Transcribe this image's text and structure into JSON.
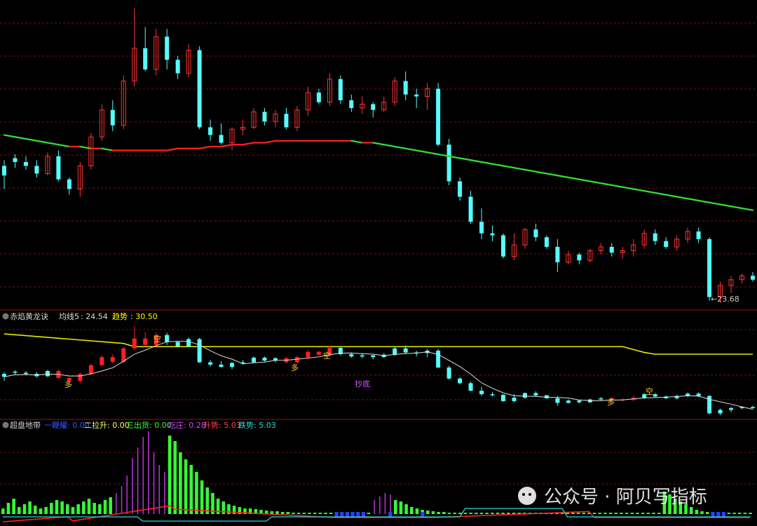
{
  "chart_data": [
    {
      "type": "candlestick",
      "panel": "main",
      "annotations": [
        "23.68"
      ],
      "series": [
        {
          "name": "ma_long",
          "values": [
            30.2,
            30.1,
            30.0,
            29.9,
            29.8,
            29.7,
            29.6,
            29.6,
            29.5,
            29.5,
            29.4,
            29.4,
            29.4,
            29.4,
            29.4,
            29.4,
            29.5,
            29.5,
            29.5,
            29.6,
            29.6,
            29.7,
            29.7,
            29.8,
            29.8,
            29.9,
            29.9,
            29.9,
            29.9,
            29.9,
            29.9,
            29.9,
            29.9,
            29.8,
            29.8,
            29.7,
            29.6,
            29.5,
            29.4,
            29.3,
            29.2,
            29.1,
            29.0,
            28.9,
            28.8,
            28.7,
            28.6,
            28.5,
            28.4,
            28.3,
            28.2,
            28.1,
            28.0,
            27.9,
            27.8,
            27.7,
            27.6,
            27.5,
            27.4,
            27.3,
            27.2,
            27.1,
            27.0,
            26.9,
            26.8,
            26.7,
            26.6,
            26.5,
            26.4,
            26.3
          ]
        }
      ],
      "candles": [
        [
          28.6,
          28.9,
          27.4,
          28.1
        ],
        [
          29.0,
          29.2,
          28.5,
          28.8
        ],
        [
          28.8,
          29.1,
          28.4,
          28.6
        ],
        [
          28.6,
          28.9,
          28.0,
          28.2
        ],
        [
          28.2,
          29.3,
          28.1,
          29.1
        ],
        [
          29.1,
          29.4,
          27.8,
          27.9
        ],
        [
          27.9,
          28.0,
          27.1,
          27.4
        ],
        [
          27.4,
          28.8,
          27.0,
          28.6
        ],
        [
          28.6,
          30.3,
          28.4,
          30.1
        ],
        [
          30.1,
          31.8,
          29.9,
          31.5
        ],
        [
          31.5,
          32.0,
          30.4,
          30.7
        ],
        [
          30.7,
          33.3,
          30.5,
          33.0
        ],
        [
          33.0,
          36.8,
          32.7,
          34.7
        ],
        [
          34.7,
          35.8,
          33.5,
          33.6
        ],
        [
          33.6,
          35.7,
          33.3,
          35.3
        ],
        [
          35.3,
          35.7,
          33.6,
          34.1
        ],
        [
          34.1,
          34.3,
          33.1,
          33.4
        ],
        [
          33.4,
          34.9,
          33.2,
          34.6
        ],
        [
          34.6,
          34.8,
          30.5,
          30.6
        ],
        [
          30.6,
          31.0,
          29.9,
          30.2
        ],
        [
          30.2,
          30.8,
          29.7,
          29.8
        ],
        [
          29.8,
          30.6,
          29.4,
          30.5
        ],
        [
          30.5,
          31.0,
          30.2,
          30.6
        ],
        [
          30.6,
          31.6,
          30.5,
          31.4
        ],
        [
          31.4,
          31.6,
          30.7,
          30.9
        ],
        [
          30.9,
          31.5,
          30.6,
          31.3
        ],
        [
          31.3,
          31.6,
          30.5,
          30.6
        ],
        [
          30.6,
          31.7,
          30.4,
          31.5
        ],
        [
          31.5,
          32.7,
          31.2,
          32.4
        ],
        [
          32.4,
          32.6,
          31.8,
          31.9
        ],
        [
          31.9,
          33.4,
          31.7,
          33.1
        ],
        [
          33.1,
          33.3,
          31.8,
          32.0
        ],
        [
          32.0,
          32.3,
          31.4,
          31.6
        ],
        [
          31.6,
          32.2,
          31.3,
          31.8
        ],
        [
          31.8,
          31.9,
          31.1,
          31.5
        ],
        [
          31.5,
          32.2,
          31.4,
          31.9
        ],
        [
          31.9,
          33.2,
          31.7,
          33.0
        ],
        [
          33.0,
          33.5,
          32.0,
          32.3
        ],
        [
          32.3,
          32.6,
          31.6,
          32.2
        ],
        [
          32.2,
          32.9,
          31.5,
          32.6
        ],
        [
          32.6,
          32.9,
          29.6,
          29.7
        ],
        [
          29.7,
          30.0,
          27.6,
          27.8
        ],
        [
          27.8,
          28.0,
          26.8,
          27.0
        ],
        [
          27.0,
          27.3,
          25.6,
          25.7
        ],
        [
          25.7,
          26.4,
          24.8,
          25.1
        ],
        [
          25.1,
          25.5,
          24.7,
          25.0
        ],
        [
          25.0,
          25.1,
          23.8,
          23.9
        ],
        [
          23.9,
          25.1,
          23.7,
          24.5
        ],
        [
          24.5,
          25.4,
          24.3,
          25.3
        ],
        [
          25.3,
          25.6,
          24.7,
          24.9
        ],
        [
          24.9,
          25.0,
          24.3,
          24.4
        ],
        [
          24.4,
          24.8,
          23.1,
          23.6
        ],
        [
          23.6,
          24.2,
          23.5,
          24.0
        ],
        [
          24.0,
          24.1,
          23.5,
          23.7
        ],
        [
          23.7,
          24.3,
          23.6,
          24.2
        ],
        [
          24.2,
          24.6,
          24.0,
          24.4
        ],
        [
          24.4,
          24.6,
          23.9,
          24.1
        ],
        [
          24.1,
          24.4,
          23.8,
          24.2
        ],
        [
          24.2,
          24.8,
          23.9,
          24.5
        ],
        [
          24.5,
          25.3,
          24.3,
          25.1
        ],
        [
          25.1,
          25.3,
          24.5,
          24.7
        ],
        [
          24.7,
          24.9,
          24.3,
          24.4
        ],
        [
          24.4,
          25.0,
          24.2,
          24.8
        ],
        [
          24.8,
          25.4,
          24.6,
          25.2
        ],
        [
          25.2,
          25.4,
          24.6,
          24.8
        ],
        [
          24.8,
          24.9,
          21.6,
          21.8
        ],
        [
          21.8,
          22.6,
          21.5,
          22.4
        ],
        [
          22.4,
          22.9,
          22.0,
          22.7
        ],
        [
          22.7,
          23.0,
          22.5,
          22.9
        ],
        [
          22.9,
          23.1,
          22.6,
          22.7
        ]
      ]
    },
    {
      "type": "line",
      "panel": "chiyan",
      "title": "赤焰黄龙诀",
      "legend": [
        {
          "name": "均线5",
          "value": "24.54",
          "color": "#dddddd"
        },
        {
          "name": "趋势",
          "value": "30.50",
          "color": "#ffff00"
        }
      ],
      "markers": [
        "多",
        "空",
        "多",
        "空",
        "抄底",
        "多",
        "空"
      ]
    },
    {
      "type": "bar",
      "panel": "chaopan",
      "title": "超盘地带",
      "legend": [
        {
          "name": "一鞭耀",
          "value": "0.00",
          "color": "#3355ff"
        },
        {
          "name": "二拉升",
          "value": "0.00",
          "color": "#ffff66"
        },
        {
          "name": "三出货",
          "value": "0.00",
          "color": "#33ff33"
        },
        {
          "name": "吃庄",
          "value": "0.28",
          "color": "#cc44ff"
        },
        {
          "name": "升势",
          "value": "5.03",
          "color": "#ff4444"
        },
        {
          "name": "跌势",
          "value": "5.03",
          "color": "#22dddd"
        }
      ]
    }
  ],
  "watermark": {
    "text": "公众号 · 阿贝写指标"
  },
  "colors": {
    "up": "#ff3333",
    "down": "#54ffff",
    "ma_up": "#ff2020",
    "ma_down": "#33dd33",
    "grid": "#7a1010"
  }
}
